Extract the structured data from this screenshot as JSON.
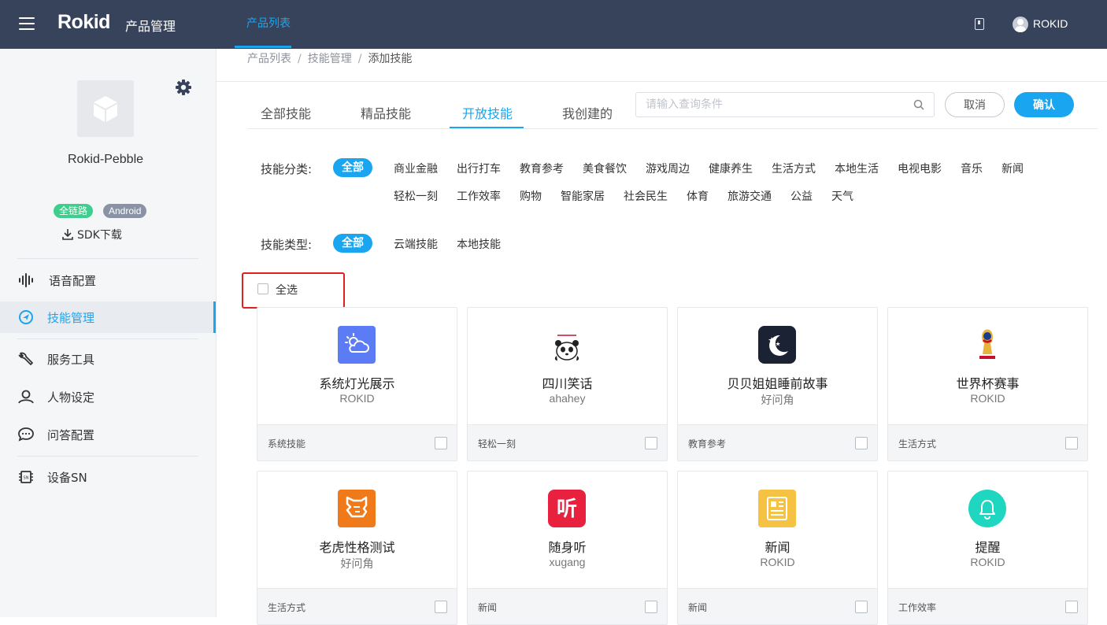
{
  "header": {
    "logo_text": "Rokid",
    "app_title": "产品管理",
    "nav_tab": "产品列表",
    "user_name": "ROKID"
  },
  "sidebar": {
    "product_name": "Rokid-Pebble",
    "badges": [
      "全链路",
      "Android"
    ],
    "sdk_download": "SDK下载",
    "nav": [
      {
        "label": "语音配置",
        "icon": "voice-wave-icon"
      },
      {
        "label": "技能管理",
        "icon": "compass-icon",
        "active": true
      },
      {
        "label": "服务工具",
        "icon": "wrench-icon"
      },
      {
        "label": "人物设定",
        "icon": "person-icon"
      },
      {
        "label": "问答配置",
        "icon": "chat-bubble-icon"
      },
      {
        "label": "设备SN",
        "icon": "chip-sn-icon"
      }
    ]
  },
  "breadcrumb": [
    "产品列表",
    "技能管理",
    "添加技能"
  ],
  "tabs": [
    "全部技能",
    "精品技能",
    "开放技能",
    "我创建的"
  ],
  "active_tab": "开放技能",
  "search": {
    "placeholder": "请输入查询条件",
    "value": ""
  },
  "buttons": {
    "cancel": "取消",
    "confirm": "确认"
  },
  "filters": {
    "category_label": "技能分类:",
    "categories": [
      "全部",
      "商业金融",
      "出行打车",
      "教育参考",
      "美食餐饮",
      "游戏周边",
      "健康养生",
      "生活方式",
      "本地生活",
      "电视电影",
      "音乐",
      "新闻",
      "轻松一刻",
      "工作效率",
      "购物",
      "智能家居",
      "社会民生",
      "体育",
      "旅游交通",
      "公益",
      "天气"
    ],
    "type_label": "技能类型:",
    "types": [
      "全部",
      "云端技能",
      "本地技能"
    ],
    "selected_category": "全部",
    "selected_type": "全部"
  },
  "select_all": {
    "label": "全选",
    "checked": false
  },
  "skills": [
    {
      "name": "系统灯光展示",
      "author": "ROKID",
      "category": "系统技能",
      "icon": "weather-cloud-icon",
      "color": "#5b7cf5",
      "checked": false
    },
    {
      "name": "四川笑话",
      "author": "ahahey",
      "category": "轻松一刻",
      "icon": "panda-icon",
      "color": "#ffffff",
      "checked": false
    },
    {
      "name": "贝贝姐姐睡前故事",
      "author": "好问角",
      "category": "教育参考",
      "icon": "moon-stars-icon",
      "color": "#1b2233",
      "checked": false
    },
    {
      "name": "世界杯赛事",
      "author": "ROKID",
      "category": "生活方式",
      "icon": "world-cup-trophy-icon",
      "color": "#c8102e",
      "checked": false
    },
    {
      "name": "老虎性格测试",
      "author": "好问角",
      "category": "生活方式",
      "icon": "tiger-icon",
      "color": "#f07a1a",
      "checked": false
    },
    {
      "name": "随身听",
      "author": "xugang",
      "category": "新闻",
      "icon": "listen-icon",
      "color": "#e8213f",
      "checked": false
    },
    {
      "name": "新闻",
      "author": "ROKID",
      "category": "新闻",
      "icon": "newspaper-icon",
      "color": "#f6c244",
      "checked": false
    },
    {
      "name": "提醒",
      "author": "ROKID",
      "category": "工作效率",
      "icon": "bell-icon",
      "color": "#1fd6c1",
      "checked": false
    }
  ],
  "icon_glyphs": {
    "listen": "听"
  }
}
